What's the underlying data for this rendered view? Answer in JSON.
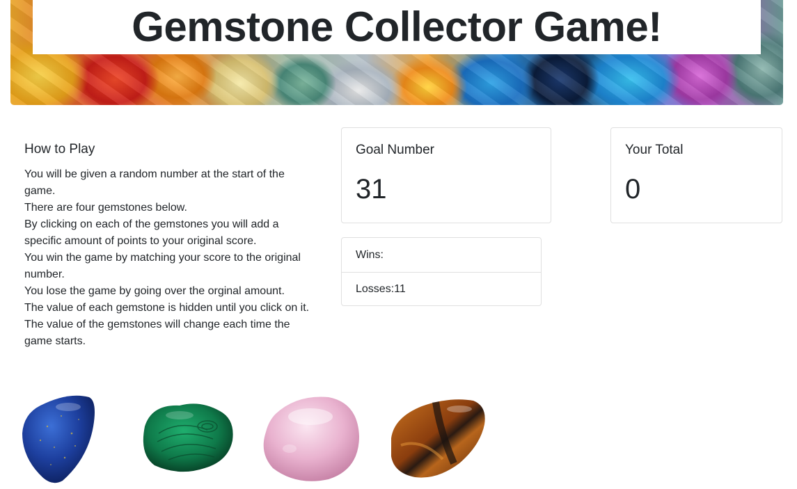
{
  "banner": {
    "title": "Gemstone Collector Game!"
  },
  "instructions": {
    "heading": "How to Play",
    "lines": [
      "You will be given a random number at the start of the game.",
      "There are four gemstones below.",
      "By clicking on each of the gemstones you will add a specific amount of points to your original score.",
      "You win the game by matching your score to the original number.",
      "You lose the game by going over the orginal amount.",
      "The value of each gemstone is hidden until you click on it.",
      "The value of the gemstones will change each time the game starts."
    ]
  },
  "goal": {
    "label": "Goal Number",
    "value": "31"
  },
  "total": {
    "label": "Your Total",
    "value": "0"
  },
  "record": {
    "wins": "Wins:",
    "losses": "Losses:11"
  },
  "gems": [
    {
      "name": "lapis-lazuli-gem",
      "color": "#1d3f9e"
    },
    {
      "name": "malachite-gem",
      "color": "#0f7a4a"
    },
    {
      "name": "rose-quartz-gem",
      "color": "#e9b2cf"
    },
    {
      "name": "tigers-eye-gem",
      "color": "#9a4a12"
    }
  ]
}
